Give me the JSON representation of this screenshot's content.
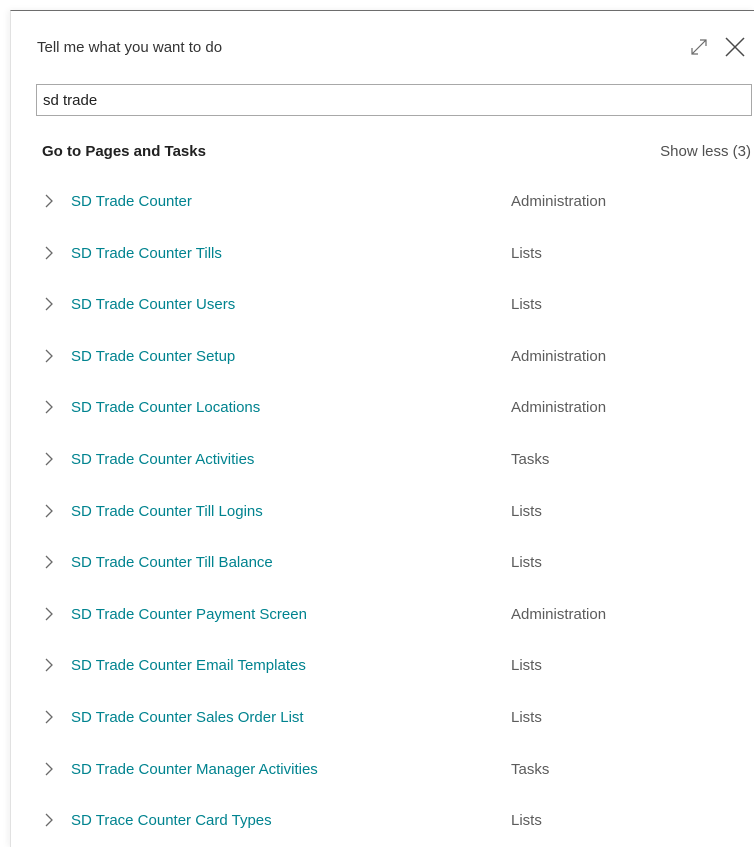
{
  "dialog": {
    "title": "Tell me what you want to do",
    "expand_icon": "expand-icon",
    "close_icon": "close-icon"
  },
  "search": {
    "value": "sd trade",
    "placeholder": ""
  },
  "section": {
    "title": "Go to Pages and Tasks",
    "show_less_label": "Show less (3)"
  },
  "results": [
    {
      "name": "SD Trade Counter",
      "category": "Administration"
    },
    {
      "name": "SD Trade Counter Tills",
      "category": "Lists"
    },
    {
      "name": "SD Trade Counter Users",
      "category": "Lists"
    },
    {
      "name": "SD Trade Counter Setup",
      "category": "Administration"
    },
    {
      "name": "SD Trade Counter Locations",
      "category": "Administration"
    },
    {
      "name": "SD Trade Counter Activities",
      "category": "Tasks"
    },
    {
      "name": "SD Trade Counter Till Logins",
      "category": "Lists"
    },
    {
      "name": "SD Trade Counter Till Balance",
      "category": "Lists"
    },
    {
      "name": "SD Trade Counter Payment Screen",
      "category": "Administration"
    },
    {
      "name": "SD Trade Counter Email Templates",
      "category": "Lists"
    },
    {
      "name": "SD Trade Counter Sales Order List",
      "category": "Lists"
    },
    {
      "name": "SD Trade Counter Manager Activities",
      "category": "Tasks"
    },
    {
      "name": "SD Trace Counter Card Types",
      "category": "Lists"
    }
  ],
  "colors": {
    "link": "#00838f",
    "category": "#5c5c5c",
    "border": "#a8a8a8"
  }
}
